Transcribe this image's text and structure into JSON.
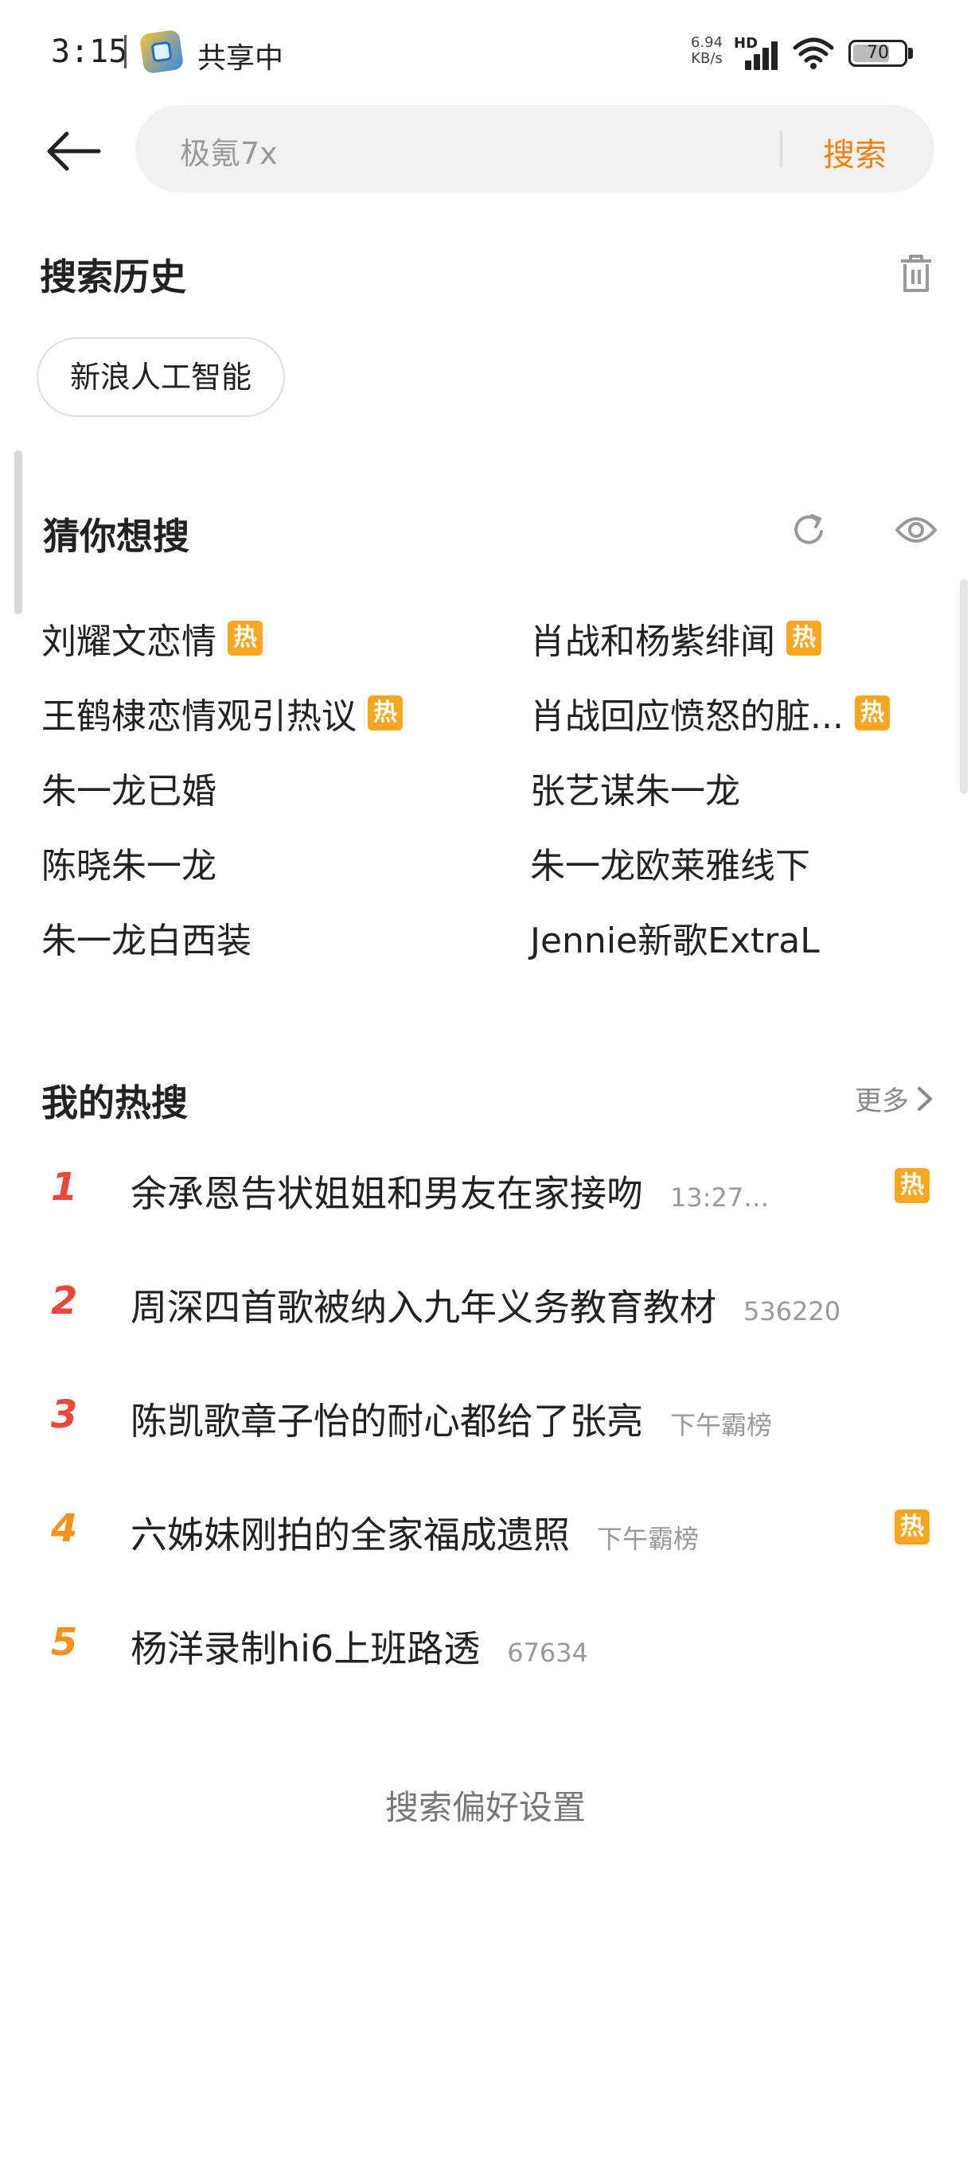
{
  "status_bar": {
    "time": "3:15",
    "sharing_label": "共享中",
    "net_speed_value": "6.94",
    "net_speed_unit": "KB/s",
    "hd_label": "HD",
    "battery": "70"
  },
  "search": {
    "placeholder": "极氪7x",
    "submit_label": "搜索"
  },
  "history": {
    "title": "搜索历史",
    "chips": [
      "新浪人工智能"
    ]
  },
  "guess": {
    "title": "猜你想搜",
    "hot_label": "热",
    "left": [
      {
        "text": "刘耀文恋情",
        "hot": true
      },
      {
        "text": "王鹤棣恋情观引热议",
        "hot": true
      },
      {
        "text": "朱一龙已婚",
        "hot": false
      },
      {
        "text": "陈晓朱一龙",
        "hot": false
      },
      {
        "text": "朱一龙白西装",
        "hot": false
      }
    ],
    "right": [
      {
        "text": "肖战和杨紫绯闻",
        "hot": true
      },
      {
        "text": "肖战回应愤怒的脏...",
        "hot": true
      },
      {
        "text": "张艺谋朱一龙",
        "hot": false
      },
      {
        "text": "朱一龙欧莱雅线下",
        "hot": false
      },
      {
        "text": "Jennie新歌ExtraL",
        "hot": false
      }
    ]
  },
  "my_hot": {
    "title": "我的热搜",
    "more_label": "更多",
    "items": [
      {
        "rank": "1",
        "text": "余承恩告状姐姐和男友在家接吻",
        "meta": "13:27…",
        "hot": true,
        "rank_color": "#e8473c"
      },
      {
        "rank": "2",
        "text": "周深四首歌被纳入九年义务教育教材",
        "meta": "536220",
        "hot": false,
        "rank_color": "#e8473c"
      },
      {
        "rank": "3",
        "text": "陈凯歌章子怡的耐心都给了张亮",
        "meta": "下午霸榜",
        "hot": false,
        "rank_color": "#e8473c"
      },
      {
        "rank": "4",
        "text": "六姊妹刚拍的全家福成遗照",
        "meta": "下午霸榜",
        "hot": true,
        "rank_color": "#f5921e"
      },
      {
        "rank": "5",
        "text": "杨洋录制hi6上班路透",
        "meta": "67634",
        "hot": false,
        "rank_color": "#f5921e"
      }
    ]
  },
  "footer": {
    "preference_label": "搜索偏好设置"
  },
  "colors": {
    "accent": "#f08010",
    "hot_badge": "#f5a623"
  }
}
